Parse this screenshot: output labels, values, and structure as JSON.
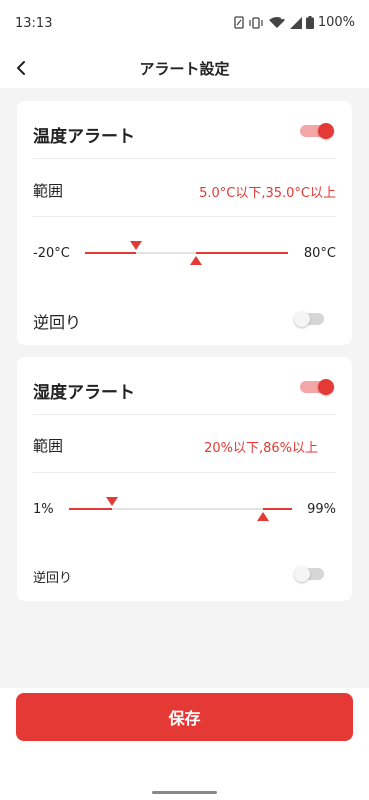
{
  "status_bar": {
    "time": "13:13",
    "battery": "100%"
  },
  "header": {
    "title": "アラート設定",
    "back_icon": "chevron-left-icon"
  },
  "temperature": {
    "title": "温度アラート",
    "enabled": true,
    "range_label": "範囲",
    "range_value": "5.0°C以下,35.0°C以上",
    "min_label": "-20°C",
    "max_label": "80°C",
    "lower_value": 5.0,
    "upper_value": 35.0,
    "reverse_label": "逆回り",
    "reverse_enabled": false
  },
  "humidity": {
    "title": "湿度アラート",
    "enabled": true,
    "range_label": "範囲",
    "range_value": "20%以下,86%以上",
    "min_label": "1%",
    "max_label": "99%",
    "lower_value": 20,
    "upper_value": 86,
    "reverse_label": "逆回り",
    "reverse_enabled": false
  },
  "save_label": "保存",
  "colors": {
    "accent": "#e53935",
    "toggle_track_on": "#f2a6a6"
  }
}
